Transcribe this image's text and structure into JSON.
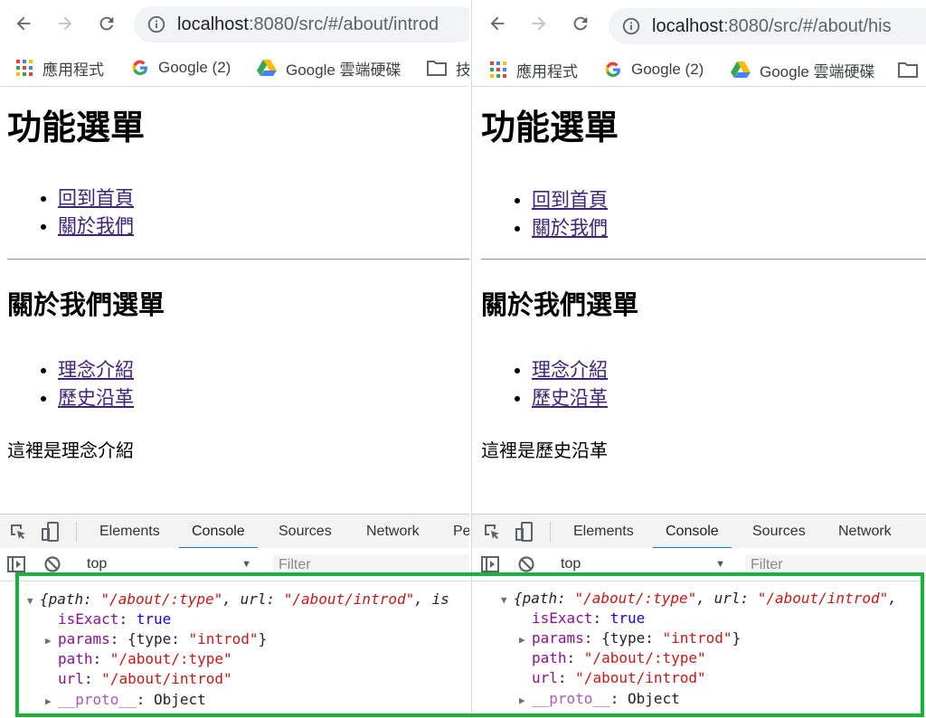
{
  "colors": {
    "link": "#3e237a",
    "highlight_border": "#18b33a",
    "devtools_active": "#1a73e8",
    "console_key": "#881391",
    "console_string": "#c41a16",
    "console_bool": "#1c00cf"
  },
  "icons": [
    "back-arrow-icon",
    "forward-arrow-icon",
    "reload-icon",
    "info-icon",
    "apps-grid-icon",
    "google-g-icon",
    "google-drive-icon",
    "folder-icon",
    "inspect-element-icon",
    "device-toolbar-icon",
    "sidebar-toggle-icon",
    "clear-console-icon"
  ],
  "left": {
    "url": {
      "host": "localhost",
      "rest": ":8080/src/#/about/introd"
    },
    "bookmarks": [
      {
        "label": "應用程式"
      },
      {
        "label": "Google (2)"
      },
      {
        "label": "Google 雲端硬碟"
      },
      {
        "label": "技"
      }
    ],
    "page": {
      "title": "功能選單",
      "main_menu": [
        "回到首頁",
        "關於我們"
      ],
      "subtitle": "關於我們選單",
      "sub_menu": [
        "理念介紹",
        "歷史沿革"
      ],
      "text": "這裡是理念介紹"
    },
    "devtools": {
      "tabs": [
        "Elements",
        "Console",
        "Sources",
        "Network",
        "Pe"
      ],
      "active_tab": "Console",
      "context": "top",
      "filter_placeholder": "Filter"
    },
    "console": {
      "summary": {
        "path_key": "path",
        "path_val": "\"/about/:type\"",
        "url_key": "url",
        "url_val": "\"/about/introd\"",
        "tail": ", is"
      },
      "isExact_key": "isExact",
      "isExact_val": "true",
      "params_key": "params",
      "params_obj_key": "type",
      "params_obj_val": "\"introd\"",
      "path_key": "path",
      "path_val": "\"/about/:type\"",
      "url_key": "url",
      "url_val": "\"/about/introd\"",
      "proto_key": "__proto__",
      "proto_val": "Object"
    }
  },
  "right": {
    "url": {
      "host": "localhost",
      "rest": ":8080/src/#/about/his"
    },
    "bookmarks": [
      {
        "label": "應用程式"
      },
      {
        "label": "Google (2)"
      },
      {
        "label": "Google 雲端硬碟"
      }
    ],
    "page": {
      "title": "功能選單",
      "main_menu": [
        "回到首頁",
        "關於我們"
      ],
      "subtitle": "關於我們選單",
      "sub_menu": [
        "理念介紹",
        "歷史沿革"
      ],
      "text": "這裡是歷史沿革"
    },
    "devtools": {
      "tabs": [
        "Elements",
        "Console",
        "Sources",
        "Network"
      ],
      "active_tab": "Console",
      "context": "top",
      "filter_placeholder": "Filter"
    },
    "console": {
      "summary": {
        "path_key": "path",
        "path_val": "\"/about/:type\"",
        "url_key": "url",
        "url_val": "\"/about/introd\"",
        "tail": ","
      },
      "isExact_key": "isExact",
      "isExact_val": "true",
      "params_key": "params",
      "params_obj_key": "type",
      "params_obj_val": "\"introd\"",
      "path_key": "path",
      "path_val": "\"/about/:type\"",
      "url_key": "url",
      "url_val": "\"/about/introd\"",
      "proto_key": "__proto__",
      "proto_val": "Object"
    }
  }
}
